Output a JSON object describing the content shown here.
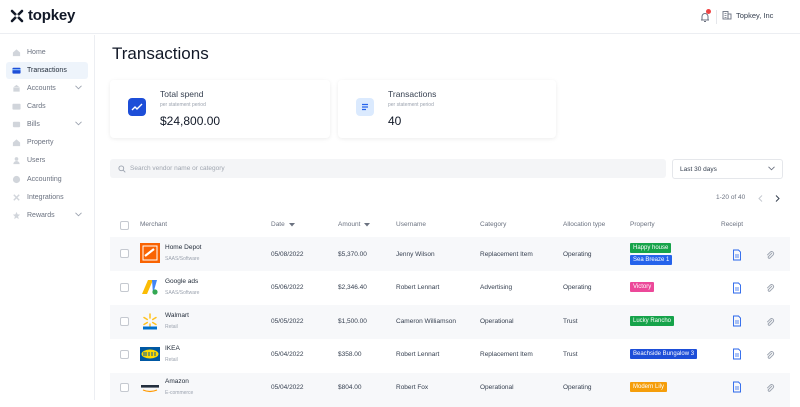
{
  "app": {
    "name": "topkey",
    "org": "Topkey, Inc"
  },
  "sidebar": {
    "items": [
      {
        "label": "Home",
        "icon": "home-icon",
        "active": false
      },
      {
        "label": "Transactions",
        "icon": "card-icon",
        "active": true
      },
      {
        "label": "Accounts",
        "icon": "bank-icon",
        "active": false,
        "expandable": true
      },
      {
        "label": "Cards",
        "icon": "credit-card-icon",
        "active": false
      },
      {
        "label": "Bills",
        "icon": "bill-icon",
        "active": false,
        "expandable": true
      },
      {
        "label": "Property",
        "icon": "building-icon",
        "active": false
      },
      {
        "label": "Users",
        "icon": "user-icon",
        "active": false
      },
      {
        "label": "Accounting",
        "icon": "accounting-icon",
        "active": false
      },
      {
        "label": "Integrations",
        "icon": "integrations-icon",
        "active": false
      },
      {
        "label": "Rewards",
        "icon": "rewards-icon",
        "active": false,
        "expandable": true
      }
    ]
  },
  "page": {
    "title": "Transactions"
  },
  "cards": [
    {
      "title": "Total spend",
      "sub": "per statement period",
      "value": "$24,800.00",
      "icon": "chart-icon"
    },
    {
      "title": "Transactions",
      "sub": "per statement period",
      "value": "40",
      "icon": "list-icon"
    }
  ],
  "search": {
    "placeholder": "Search vendor name or category"
  },
  "filter": {
    "selected": "Last 30 days"
  },
  "pagination": {
    "text": "1-20 of 40"
  },
  "table": {
    "headers": {
      "merchant": "Merchant",
      "date": "Date",
      "amount": "Amount",
      "username": "Username",
      "category": "Category",
      "allocation": "Allocation type",
      "property": "Property",
      "receipt": "Receipt"
    },
    "rows": [
      {
        "merchant": "Home Depot",
        "merchant_cat": "SAAS/Software",
        "logo": "home-depot-logo",
        "date": "05/08/2022",
        "amount": "$5,370.00",
        "username": "Jenny Wilson",
        "category": "Replacement Item",
        "allocation": "Operating",
        "properties": [
          {
            "label": "Happy house",
            "color": "#16a34a"
          },
          {
            "label": "Sea Breaze 1",
            "color": "#2563eb"
          }
        ]
      },
      {
        "merchant": "Google ads",
        "merchant_cat": "SAAS/Software",
        "logo": "google-ads-logo",
        "date": "05/06/2022",
        "amount": "$2,346.40",
        "username": "Robert Lennart",
        "category": "Advertising",
        "allocation": "Operating",
        "properties": [
          {
            "label": "Victory",
            "color": "#ec4899"
          }
        ]
      },
      {
        "merchant": "Walmart",
        "merchant_cat": "Retail",
        "logo": "walmart-logo",
        "date": "05/05/2022",
        "amount": "$1,500.00",
        "username": "Cameron Williamson",
        "category": "Operational",
        "allocation": "Trust",
        "properties": [
          {
            "label": "Lucky Rancho",
            "color": "#16a34a"
          }
        ]
      },
      {
        "merchant": "IKEA",
        "merchant_cat": "Retail",
        "logo": "ikea-logo",
        "date": "05/04/2022",
        "amount": "$358.00",
        "username": "Robert Lennart",
        "category": "Replacement Item",
        "allocation": "Trust",
        "properties": [
          {
            "label": "Beachside Bungalow 3",
            "color": "#1d4ed8"
          }
        ]
      },
      {
        "merchant": "Amazon",
        "merchant_cat": "E-commerce",
        "logo": "amazon-logo",
        "date": "05/04/2022",
        "amount": "$804.00",
        "username": "Robert Fox",
        "category": "Operational",
        "allocation": "Operating",
        "properties": [
          {
            "label": "Modern Lily",
            "color": "#f59e0b"
          }
        ]
      }
    ]
  },
  "colors": {
    "accent": "#1d4ed8",
    "active_nav_bg": "#eef4fb",
    "row_alt": "#f7f8fa"
  }
}
